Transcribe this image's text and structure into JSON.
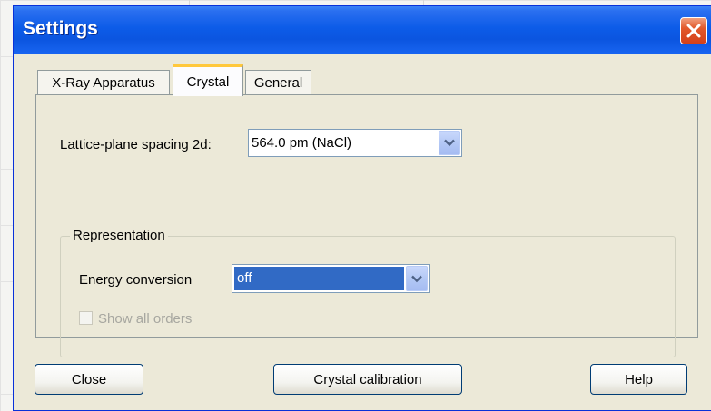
{
  "window": {
    "title": "Settings"
  },
  "tabs": [
    {
      "label": "X-Ray Apparatus",
      "active": false
    },
    {
      "label": "Crystal",
      "active": true
    },
    {
      "label": "General",
      "active": false
    }
  ],
  "crystal": {
    "lattice_label": "Lattice-plane spacing 2d:",
    "lattice_value": "564.0 pm (NaCl)",
    "representation_legend": "Representation",
    "energy_label": "Energy conversion",
    "energy_value": "off",
    "show_orders_label": "Show all orders",
    "show_orders_checked": false,
    "show_orders_enabled": false
  },
  "buttons": {
    "close": "Close",
    "calibration": "Crystal calibration",
    "help": "Help"
  },
  "icons": {
    "close": "close-x-icon",
    "dropdown": "chevron-down-icon"
  },
  "colors": {
    "titlebar": "#0b55e0",
    "dialog_bg": "#ece9d8",
    "selection": "#316ac5",
    "close_button": "#d4411a",
    "tab_highlight": "#ffc83c"
  }
}
